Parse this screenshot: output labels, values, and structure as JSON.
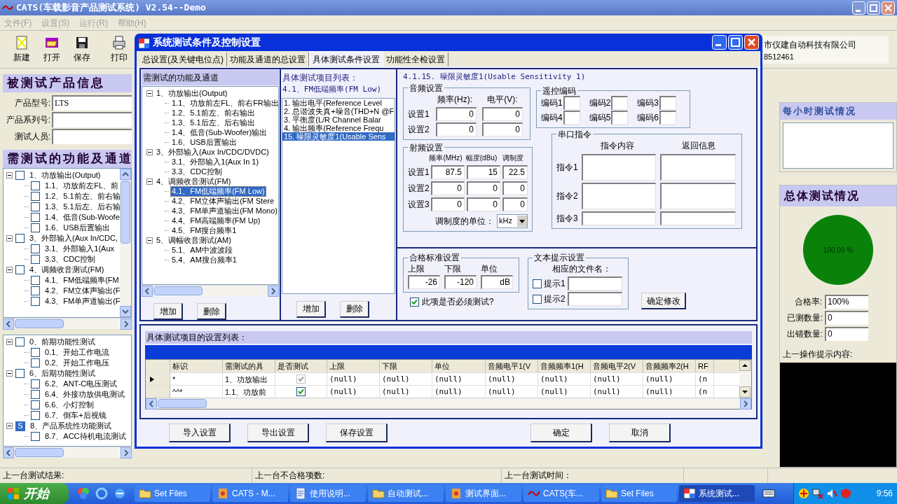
{
  "main": {
    "title": "CATS(车载影音产品测试系统) V2.54--Demo",
    "menu": [
      "文件(F)",
      "设置(S)",
      "运行(R)",
      "帮助(H)"
    ],
    "toolbar": [
      {
        "label": "新建",
        "kind": "new"
      },
      {
        "label": "打开",
        "kind": "open"
      },
      {
        "label": "保存",
        "kind": "save"
      },
      {
        "label": "打印",
        "kind": "print"
      }
    ],
    "company": {
      "name": "市仪建自动科技有限公司",
      "phone": "8512461"
    },
    "product_info": {
      "title": "被测试产品信息",
      "fields": [
        {
          "label": "产品型号:",
          "value": "LTS"
        },
        {
          "label": "产品系列号:"
        },
        {
          "label": "测试人员:"
        }
      ]
    },
    "channels": {
      "title": "需测试的功能及通道",
      "tree": [
        {
          "label": "1、功放输出(Output)",
          "checked": false,
          "expanded": true,
          "children": [
            {
              "label": "1.1、功放前左FL、前",
              "checked": false
            },
            {
              "label": "1.2、5.1前左、前右输",
              "checked": false
            },
            {
              "label": "1.3、5.1后左、后右输",
              "checked": false
            },
            {
              "label": "1.4、低音(Sub-Woofe",
              "checked": false
            },
            {
              "label": "1.6、USB后置输出",
              "checked": false
            }
          ]
        },
        {
          "label": "3、外部输入(Aux In/CDC,",
          "checked": false,
          "expanded": true,
          "children": [
            {
              "label": "3.1、外部输入1(Aux",
              "checked": false
            },
            {
              "label": "3.3、CDC控制",
              "checked": false
            }
          ]
        },
        {
          "label": "4、调频收音测试(FM)",
          "checked": false,
          "expanded": true,
          "children": [
            {
              "label": "4.1、FM低端频率(FM",
              "checked": false
            },
            {
              "label": "4.2、FM立体声输出(F",
              "checked": false
            },
            {
              "label": "4.3、FM单声道输出(F",
              "checked": false
            }
          ]
        }
      ]
    },
    "later_tests": [
      {
        "label": "0、前期功能性测试",
        "checked": false,
        "expanded": true,
        "children": [
          {
            "label": "0.1、开始工作电流",
            "checked": false
          },
          {
            "label": "0.2、开始工作电压",
            "checked": false
          }
        ]
      },
      {
        "label": "6、后期功能性测试",
        "checked": false,
        "expanded": true,
        "children": [
          {
            "label": "6.2、ANT-C电压测试",
            "checked": false
          },
          {
            "label": "6.4、外接功放供电测试",
            "checked": false
          },
          {
            "label": "6.6、小灯控制",
            "checked": false
          },
          {
            "label": "6.7、倒车+后视镜",
            "checked": false
          }
        ]
      },
      {
        "label": "8、产品系统性功能测试",
        "mark": "S",
        "expanded": true,
        "children": [
          {
            "label": "8.7、ACC待机电流测试",
            "checked": false
          }
        ]
      }
    ],
    "hourly": {
      "title": "每小时测试情况"
    },
    "overall": {
      "title": "总体测试情况",
      "gauge": "100.00 %",
      "fields": [
        {
          "label": "合格率:",
          "value": "100%"
        },
        {
          "label": "已测数量:",
          "value": "0"
        },
        {
          "label": "出错数量:",
          "value": "0"
        }
      ],
      "prompt_label": "上一操作提示内容:"
    },
    "status_bar": [
      "上一台测试结果:",
      "上一台不合格项数:",
      "上一台测试时间："
    ]
  },
  "dialog": {
    "title": "系统测试条件及控制设置",
    "tabs": [
      {
        "label": "总设置(及关键电位点)",
        "selected": false
      },
      {
        "label": "功能及通道的总设置",
        "selected": false
      },
      {
        "label": "具体测试条件设置",
        "selected": true
      },
      {
        "label": "功能性全检设置",
        "selected": false
      }
    ],
    "tree_panel": {
      "title": "需测试的功能及通道",
      "tree": [
        {
          "label": "1、功放输出(Output)",
          "selected": false,
          "expanded": true,
          "children": [
            {
              "label": "1.1、功放前左FL、前右FR输出",
              "selected": false
            },
            {
              "label": "1.2、5.1前左、前右输出",
              "selected": false
            },
            {
              "label": "1.3、5.1后左、后右输出",
              "selected": false
            },
            {
              "label": "1.4、低音(Sub-Woofer)输出",
              "selected": false
            },
            {
              "label": "1.6、USB后置输出",
              "selected": false
            }
          ]
        },
        {
          "label": "3、外部输入(Aux In/CDC/DVDC)",
          "selected": false,
          "expanded": true,
          "children": [
            {
              "label": "3.1、外部输入1(Aux In 1)",
              "selected": false
            },
            {
              "label": "3.3、CDC控制",
              "selected": false
            }
          ]
        },
        {
          "label": "4、调频收音测试(FM)",
          "selected": false,
          "expanded": true,
          "children": [
            {
              "label": "4.1、FM低端频率(FM Low)",
              "selected": true
            },
            {
              "label": "4.2、FM立体声输出(FM Stere",
              "selected": false
            },
            {
              "label": "4.3、FM单声道输出(FM Mono)",
              "selected": false
            },
            {
              "label": "4.4、FM高端频率(FM Up)",
              "selected": false
            },
            {
              "label": "4.5、FM搜台频率1",
              "selected": false
            }
          ]
        },
        {
          "label": "5、调幅收音测试(AM)",
          "selected": false,
          "expanded": true,
          "children": [
            {
              "label": "5.1、AM中波波段",
              "selected": false
            },
            {
              "label": "5.4、AM搜台频率1",
              "selected": false
            }
          ]
        }
      ],
      "buttons": [
        "增加",
        "删除"
      ]
    },
    "items_panel": {
      "title": "具体测试项目列表：",
      "subtitle": "4.1、FM低端频率(FM Low)",
      "items": [
        {
          "label": "1. 输出电平(Reference Level",
          "selected": false
        },
        {
          "label": "2. 总谐波失真+噪音(THD+N @F",
          "selected": false
        },
        {
          "label": "3. 平衡度(L/R Channel Balar",
          "selected": false
        },
        {
          "label": "4. 输出频率(Reference Frequ",
          "selected": false
        },
        {
          "label": "15. 噪限灵敏度1(Usable Sens",
          "selected": true
        }
      ],
      "buttons": [
        "增加",
        "删除"
      ]
    },
    "detail": {
      "heading": "4.1.15. 噪限灵敏度1(Usable Sensitivity 1)",
      "audio": {
        "title": "音频设置",
        "columns": [
          "频率(Hz):",
          "电平(V):"
        ],
        "rows": [
          {
            "label": "设置1",
            "values": [
              "0",
              "0"
            ]
          },
          {
            "label": "设置2",
            "values": [
              "0",
              "0"
            ]
          }
        ]
      },
      "remote": {
        "title": "遥控编码",
        "codes": [
          "编码1",
          "编码2",
          "编码3",
          "编码4",
          "编码5",
          "编码6"
        ]
      },
      "rf": {
        "title": "射频设置",
        "columns": [
          "频率(MHz)",
          "幅度(dBu)",
          "调制度"
        ],
        "rows": [
          {
            "label": "设置1",
            "values": [
              "87.5",
              "15",
              "22.5"
            ]
          },
          {
            "label": "设置2",
            "values": [
              "0",
              "0",
              "0"
            ]
          },
          {
            "label": "设置3",
            "values": [
              "0",
              "0",
              "0"
            ]
          }
        ],
        "unit_label": "调制度的单位：",
        "unit": "kHz"
      },
      "serial": {
        "title": "串口指令",
        "columns": [
          "指令内容",
          "返回信息"
        ],
        "rows": [
          "指令1",
          "指令2",
          "指令3"
        ]
      },
      "limits": {
        "title": "合格标准设置",
        "fields": [
          {
            "label": "上限",
            "value": "-26"
          },
          {
            "label": "下限",
            "value": "-120"
          },
          {
            "label": "单位",
            "value": "dB"
          }
        ]
      },
      "required": {
        "label": "此项是否必须测试?",
        "checked": true
      },
      "hints": {
        "title": "文本提示设置",
        "caption": "相应的文件名：",
        "items": [
          {
            "label": "提示1",
            "checked": false
          },
          {
            "label": "提示2",
            "checked": false
          }
        ]
      },
      "confirm": "确定修改"
    },
    "table": {
      "title": "具体测试项目的设置列表：",
      "columns": [
        "标识",
        "需测试的具",
        "是否测试",
        "上限",
        "下限",
        "单位",
        "音频电平1(V",
        "音频频率1(H",
        "音频电平2(V",
        "音频频率2(H",
        "RF"
      ],
      "rows": [
        {
          "selected": true,
          "id": "*",
          "item": "1、功放输出",
          "test": {
            "checked": true,
            "disabled": true
          },
          "values": [
            "(null)",
            "(null)",
            "(null)",
            "(null)",
            "(null)",
            "(null)",
            "(null)",
            "(n"
          ]
        },
        {
          "selected": false,
          "id": "^^*",
          "item": "1.1、功放前",
          "test": {
            "checked": true,
            "disabled": false
          },
          "values": [
            "(null)",
            "(null)",
            "(null)",
            "(null)",
            "(null)",
            "(null)",
            "(null)",
            "(n"
          ]
        }
      ]
    },
    "buttons": [
      "导入设置",
      "导出设置",
      "保存设置",
      "确定",
      "取消"
    ]
  },
  "taskbar": {
    "start": "开始",
    "tasks": [
      {
        "label": "Set Files",
        "kind": "folder",
        "selected": false
      },
      {
        "label": "CATS - M...",
        "kind": "app",
        "selected": false
      },
      {
        "label": "使用说明...",
        "kind": "doc",
        "selected": false
      },
      {
        "label": "自动测试...",
        "kind": "folder",
        "selected": false
      },
      {
        "label": "测试界面...",
        "kind": "app",
        "selected": false
      },
      {
        "label": "CATS(车...",
        "kind": "wave",
        "selected": false
      },
      {
        "label": "Set Files",
        "kind": "folder",
        "selected": false
      },
      {
        "label": "系统测试...",
        "kind": "window",
        "selected": true
      }
    ],
    "clock": "9:56"
  }
}
